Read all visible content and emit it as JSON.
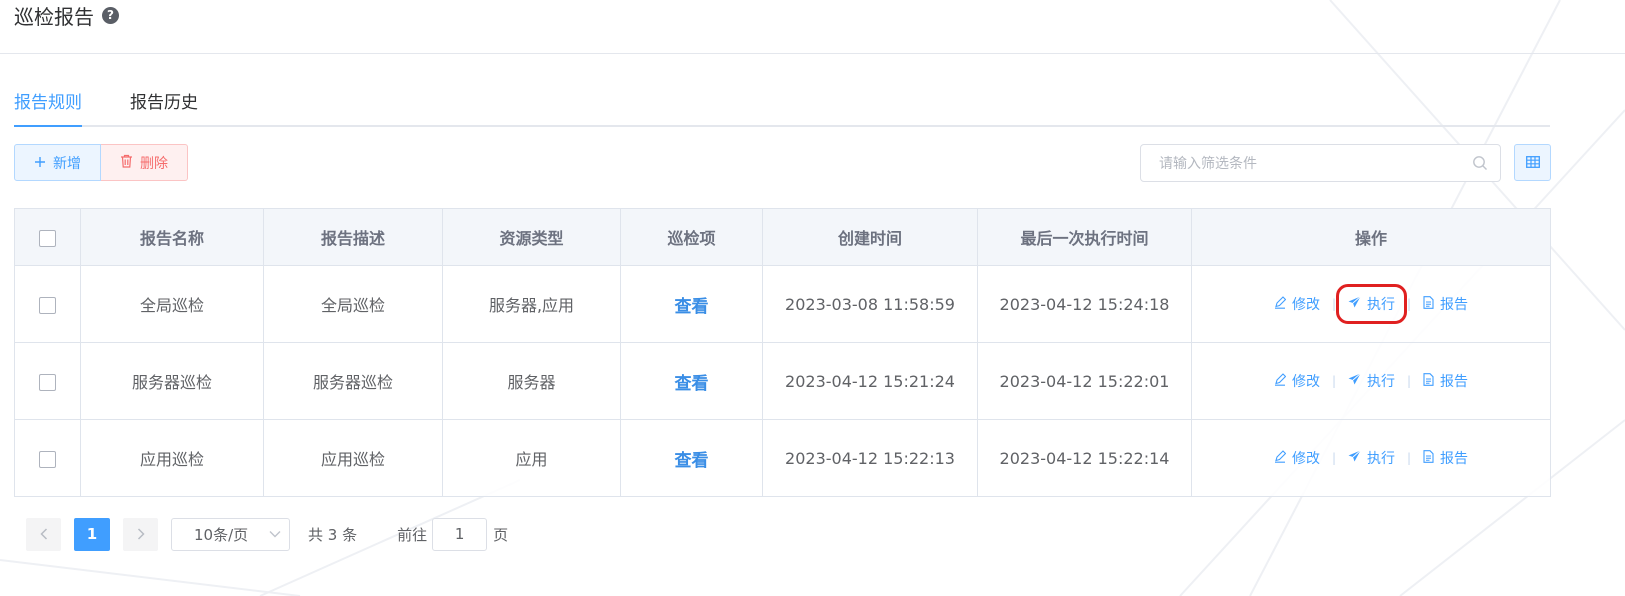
{
  "header": {
    "title": "巡检报告",
    "help_icon": "question-circle-icon"
  },
  "tabs": [
    {
      "label": "报告规则",
      "active": true
    },
    {
      "label": "报告历史",
      "active": false
    }
  ],
  "toolbar": {
    "add_label": "新增",
    "add_icon": "plus-icon",
    "delete_label": "删除",
    "delete_icon": "trash-icon",
    "search_placeholder": "请输入筛选条件",
    "search_icon": "search-icon",
    "grid_icon": "table-grid-icon"
  },
  "table": {
    "columns": [
      "报告名称",
      "报告描述",
      "资源类型",
      "巡检项",
      "创建时间",
      "最后一次执行时间",
      "操作"
    ],
    "rows": [
      {
        "name": "全局巡检",
        "desc": "全局巡检",
        "resource": "服务器,应用",
        "items": "查看",
        "created": "2023-03-08 11:58:59",
        "last_run": "2023-04-12 15:24:18",
        "ops": [
          "修改",
          "执行",
          "报告"
        ]
      },
      {
        "name": "服务器巡检",
        "desc": "服务器巡检",
        "resource": "服务器",
        "items": "查看",
        "created": "2023-04-12 15:21:24",
        "last_run": "2023-04-12 15:22:01",
        "ops": [
          "修改",
          "执行",
          "报告"
        ]
      },
      {
        "name": "应用巡检",
        "desc": "应用巡检",
        "resource": "应用",
        "items": "查看",
        "created": "2023-04-12 15:22:13",
        "last_run": "2023-04-12 15:22:14",
        "ops": [
          "修改",
          "执行",
          "报告"
        ]
      }
    ],
    "highlighted": {
      "row": 0,
      "op": "执行"
    }
  },
  "pagination": {
    "current_page": "1",
    "page_size": "10条/页",
    "total": "共 3 条",
    "goto_label": "前往",
    "goto_value": "1",
    "goto_unit": "页"
  },
  "colors": {
    "accent": "#409eff",
    "danger": "#f56c6c",
    "highlight": "#e02020"
  }
}
